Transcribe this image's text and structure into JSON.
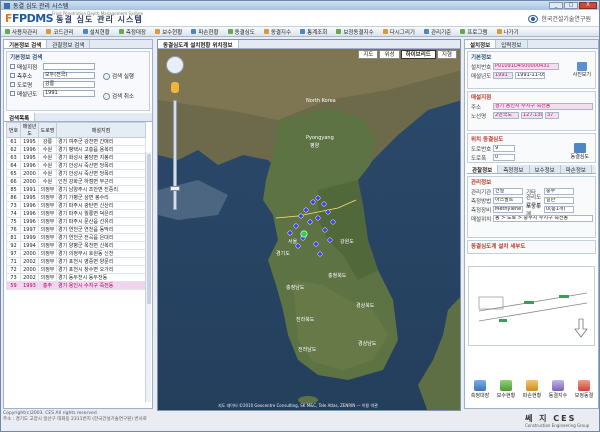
{
  "window": {
    "title": "동결 심도 관리 시스템",
    "buttons": [
      "_",
      "□",
      "X"
    ]
  },
  "header": {
    "logo_mark": "FPDMS",
    "logo_title": "동결 심도 관리 시스템",
    "logo_sub": "Frost Penetration Depth Management System",
    "institute": "한국건설기술연구원"
  },
  "menu": [
    "사용자관리",
    "코드관리",
    "설치현황",
    "측정대장",
    "보수현황",
    "파손현황",
    "동결심도",
    "동결지수",
    "통계조회",
    "보정동결지수",
    "다시그리기",
    "관리기준",
    "프로그램",
    "나가기"
  ],
  "left": {
    "tabs": [
      "기본정보 검색",
      "관찰정보 검색"
    ],
    "section_title": "기본정보 검색",
    "filters": [
      {
        "label": "매설지점",
        "value": ""
      },
      {
        "label": "측후소",
        "value": "모두(전국)"
      },
      {
        "label": "도로명",
        "value": "강릉"
      },
      {
        "label": "매설년도",
        "value": "1991"
      }
    ],
    "search_btn": "검색 실행",
    "reset_btn": "검색 취소",
    "list_tab": "검색목록",
    "columns": [
      "번호",
      "매설년도",
      "도로명",
      "매설지점"
    ],
    "rows": [
      [
        "61",
        "1995",
        "강릉",
        "경기 여주군 강천면 간매리"
      ],
      [
        "62",
        "1996",
        "수원",
        "경기 평택시 고층읍 용복리"
      ],
      [
        "63",
        "1995",
        "수원",
        "경기 화성시 봉담면 지봉리"
      ],
      [
        "64",
        "1996",
        "수원",
        "경기 안성시 죽산면 당목리"
      ],
      [
        "65",
        "2000",
        "수원",
        "경기 안성시 죽산면 당목리"
      ],
      [
        "66",
        "2000",
        "수원",
        "인천 강화군 하점면 부근리"
      ],
      [
        "85",
        "1991",
        "의정부",
        "경기 남양주시 조안면 진중리"
      ],
      [
        "86",
        "1995",
        "의정부",
        "경기 가평군 상면 봉수리"
      ],
      [
        "73",
        "1996",
        "의정부",
        "경기 파주시 광탄면 신산리"
      ],
      [
        "74",
        "1996",
        "의정부",
        "경기 파주시 월롱면 덕은리"
      ],
      [
        "75",
        "1996",
        "의정부",
        "경기 파주시 문산읍 선유리"
      ],
      [
        "76",
        "1997",
        "의정부",
        "경기 연천군 연천읍 동막리"
      ],
      [
        "81",
        "1999",
        "의정부",
        "경기 연천군 전곡읍 은대리"
      ],
      [
        "92",
        "1994",
        "의정부",
        "경기 양평군 옥천면 신복리"
      ],
      [
        "97",
        "2000",
        "의정부",
        "경기 의정부시 호원동 신천"
      ],
      [
        "71",
        "2002",
        "의정부",
        "경기 포천시 영중면 양문리"
      ],
      [
        "72",
        "2000",
        "의정부",
        "경기 포천시 창수면 오가리"
      ],
      [
        "73",
        "2002",
        "의정부",
        "경기 동두천시 동두천동"
      ],
      [
        "59",
        "1993",
        "충주",
        "경기 용인시 수지구 죽전동"
      ]
    ],
    "selected_row": 18,
    "footer_line1": "Copyright(c)2003. CES All rights reserved",
    "footer_line2": "주소 : 경기도 고양시 일산구 대화동 2311번지 (한국건설기술연구원) 번사로"
  },
  "map": {
    "tabs": [
      "동결심도계 설치현황 위치정보"
    ],
    "types": [
      "지도",
      "위성",
      "하이브리드",
      "지형"
    ],
    "active_type": "하이브리드",
    "copyright": "지도 데이터 ©2010 Geocentre Consulting, SK M&C, Tele Atlas, ZENRIN — 이용 약관",
    "labels": [
      {
        "text": "North Korea"
      },
      {
        "text": "Pyongyang"
      },
      {
        "text": "평양"
      },
      {
        "text": "서울"
      },
      {
        "text": "경기도"
      },
      {
        "text": "강원도"
      },
      {
        "text": "충청북도"
      },
      {
        "text": "충청남도"
      },
      {
        "text": "경상북도"
      },
      {
        "text": "전라북도"
      },
      {
        "text": "전라남도"
      },
      {
        "text": "경상남도"
      }
    ]
  },
  "right": {
    "tabs": [
      "설치정보",
      "입력정보"
    ],
    "section1": "기본정보",
    "id_label": "설치번호",
    "id_value": "P01091D4500000431",
    "year_label": "매설년도",
    "year_value": "1991",
    "date_value": "1991-11-05",
    "photo_btn": "사진보기",
    "section2": "매설지점",
    "addr_label": "주소",
    "addr_value": "경기 용인시 수지구 죽전동",
    "km_label": "노선명",
    "km_values": [
      "2번국도",
      "127.130",
      "37"
    ],
    "road_label": "도로번호",
    "road_value": "9",
    "alt_label": "도로폭",
    "alt_value": "0",
    "section3": "위치 동결심도",
    "road_type": "동결심도",
    "info_tabs": [
      "관찰정보",
      "측정정보",
      "보수정보",
      "파손정보"
    ],
    "section4": "관리정보",
    "mg_rows": [
      [
        "관리기관",
        "건설",
        "기타",
        "충주"
      ],
      [
        "측정방법",
        "아스팔트",
        "관리도로구분",
        "일반"
      ],
      [
        "측정장비",
        "Methylene Blue",
        "포장두께",
        "0(총1개)"
      ],
      [
        "매설위치",
        "동 > 도로 > 충주시 수지구 죽전동",
        "",
        ""
      ]
    ],
    "section5": "동결심도계 설치 세부도",
    "bottom_btns": [
      "측정대장",
      "보수현황",
      "파손현황",
      "동결지수",
      "보정동결"
    ]
  },
  "company": {
    "name": "쎄 지 CES",
    "sub": "Construction Engineering Group"
  }
}
